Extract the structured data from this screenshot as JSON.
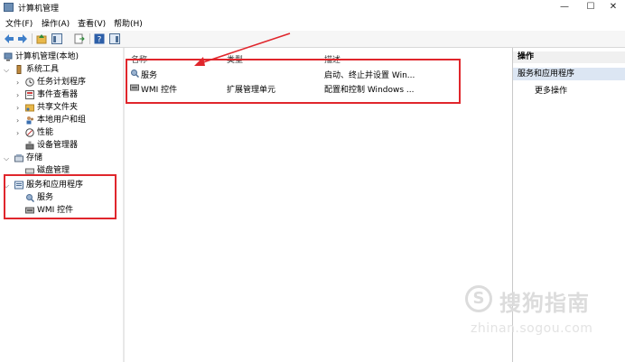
{
  "window": {
    "title": "计算机管理",
    "minimize": "—",
    "maximize": "☐",
    "close": "✕"
  },
  "menu": [
    "文件(F)",
    "操作(A)",
    "查看(V)",
    "帮助(H)"
  ],
  "tree": {
    "root": "计算机管理(本地)",
    "items": [
      {
        "label": "系统工具"
      },
      {
        "label": "任务计划程序"
      },
      {
        "label": "事件查看器"
      },
      {
        "label": "共享文件夹"
      },
      {
        "label": "本地用户和组"
      },
      {
        "label": "性能"
      },
      {
        "label": "设备管理器"
      },
      {
        "label": "存储"
      },
      {
        "label": "磁盘管理"
      },
      {
        "label": "服务和应用程序"
      },
      {
        "label": "服务"
      },
      {
        "label": "WMI 控件"
      }
    ]
  },
  "list": {
    "columns": [
      "名称",
      "类型",
      "描述"
    ],
    "rows": [
      {
        "name": "服务",
        "type": "",
        "desc": "启动、终止并设置 Win..."
      },
      {
        "name": "WMI 控件",
        "type": "扩展管理单元",
        "desc": "配置和控制 Windows ..."
      }
    ]
  },
  "actions": {
    "header": "操作",
    "section": "服务和应用程序",
    "more": "更多操作"
  },
  "watermark": {
    "symbol": "S",
    "text": "搜狗指南",
    "url": "zhinan.sogou.com"
  },
  "colors": {
    "highlight_box": "#e0262c",
    "selection": "#dce6f3"
  }
}
